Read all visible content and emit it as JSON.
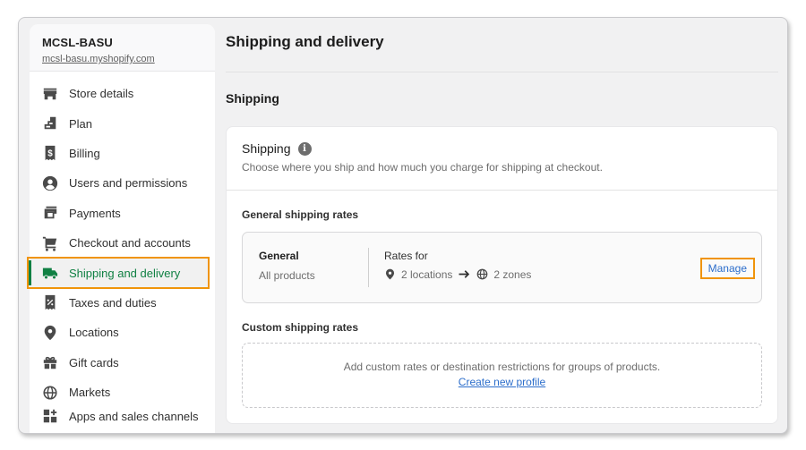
{
  "store": {
    "name": "MCSL-BASU",
    "url": "mcsl-basu.myshopify.com"
  },
  "sidebar": {
    "items": [
      {
        "label": "Store details",
        "icon": "store-icon"
      },
      {
        "label": "Plan",
        "icon": "plan-icon"
      },
      {
        "label": "Billing",
        "icon": "billing-icon"
      },
      {
        "label": "Users and permissions",
        "icon": "user-icon"
      },
      {
        "label": "Payments",
        "icon": "payments-icon"
      },
      {
        "label": "Checkout and accounts",
        "icon": "cart-icon"
      },
      {
        "label": "Shipping and delivery",
        "icon": "truck-icon",
        "active": true
      },
      {
        "label": "Taxes and duties",
        "icon": "tax-icon"
      },
      {
        "label": "Locations",
        "icon": "location-icon"
      },
      {
        "label": "Gift cards",
        "icon": "gift-icon"
      },
      {
        "label": "Markets",
        "icon": "globe-icon"
      },
      {
        "label": "Apps and sales channels",
        "icon": "apps-icon"
      }
    ]
  },
  "main": {
    "page_title": "Shipping and delivery",
    "section_title": "Shipping",
    "card": {
      "title": "Shipping",
      "info_glyph": "i",
      "subtitle": "Choose where you ship and how much you charge for shipping at checkout.",
      "general_heading": "General shipping rates",
      "general_profile": {
        "name": "General",
        "scope": "All products",
        "rates_label": "Rates for",
        "locations": "2 locations",
        "zones": "2 zones",
        "manage_label": "Manage"
      },
      "custom_heading": "Custom shipping rates",
      "custom_text": "Add custom rates or destination restrictions for groups of products.",
      "create_profile_label": "Create new profile"
    }
  },
  "colors": {
    "active_green": "#108043",
    "highlight_orange": "#f0940a",
    "link_blue": "#2c6ecb"
  }
}
